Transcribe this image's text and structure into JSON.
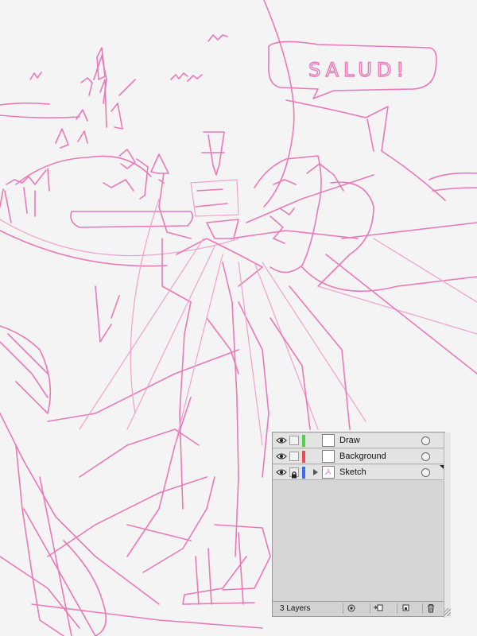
{
  "canvas": {
    "speech_text": "SALUD!",
    "stroke_color": "#ea79b7",
    "background_color": "#f4f4f4"
  },
  "layers_panel": {
    "layers": [
      {
        "name": "Draw",
        "color": "#4fd14a",
        "locked": false,
        "expandable": false,
        "selected": false
      },
      {
        "name": "Background",
        "color": "#ef4b4b",
        "locked": false,
        "expandable": false,
        "selected": false
      },
      {
        "name": "Sketch",
        "color": "#3a6cf0",
        "locked": true,
        "expandable": true,
        "selected": true
      }
    ],
    "footer": {
      "count_label": "3 Layers",
      "buttons": [
        "locate-object",
        "make-clipping-mask",
        "create-sublayer",
        "create-layer",
        "delete-layer"
      ]
    },
    "icons": {
      "visibility": "eye-icon",
      "lock": "lock-icon",
      "expand": "triangle-right-icon",
      "target": "target-circle-icon",
      "delete": "trash-icon"
    }
  }
}
